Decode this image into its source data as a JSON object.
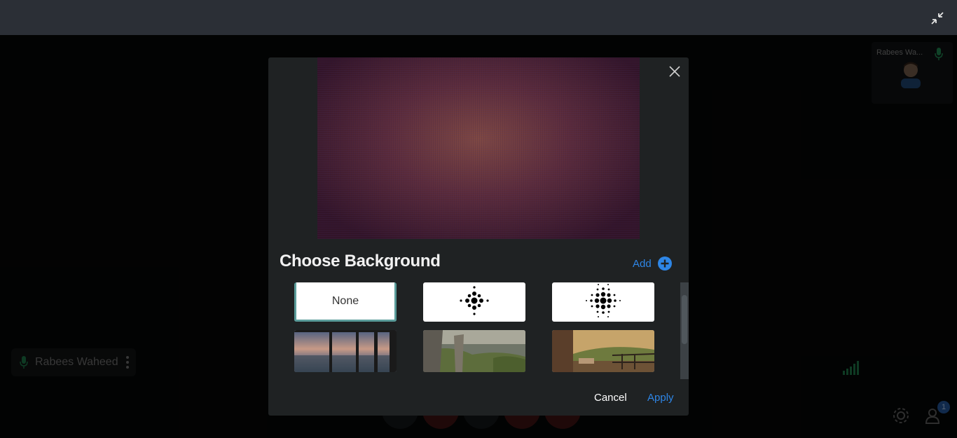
{
  "call": {
    "participant_name": "Rabees Waheed",
    "self_tile_name": "Rabees Wa...",
    "participants_count": "1"
  },
  "modal": {
    "title": "Choose Background",
    "add_label": "Add",
    "backgrounds": [
      {
        "name": "None",
        "type": "none",
        "selected": true
      },
      {
        "name": "blur-light",
        "type": "blur-icon"
      },
      {
        "name": "blur-strong",
        "type": "blur-icon"
      },
      {
        "name": "city-window",
        "type": "image"
      },
      {
        "name": "rock-forest",
        "type": "image"
      },
      {
        "name": "balcony-forest",
        "type": "image"
      }
    ],
    "cancel_label": "Cancel",
    "apply_label": "Apply"
  },
  "colors": {
    "accent": "#2e86e6",
    "selected_border": "#5a9c9a",
    "modal_bg": "#1f2223",
    "topbar_bg": "#2b2f36"
  }
}
